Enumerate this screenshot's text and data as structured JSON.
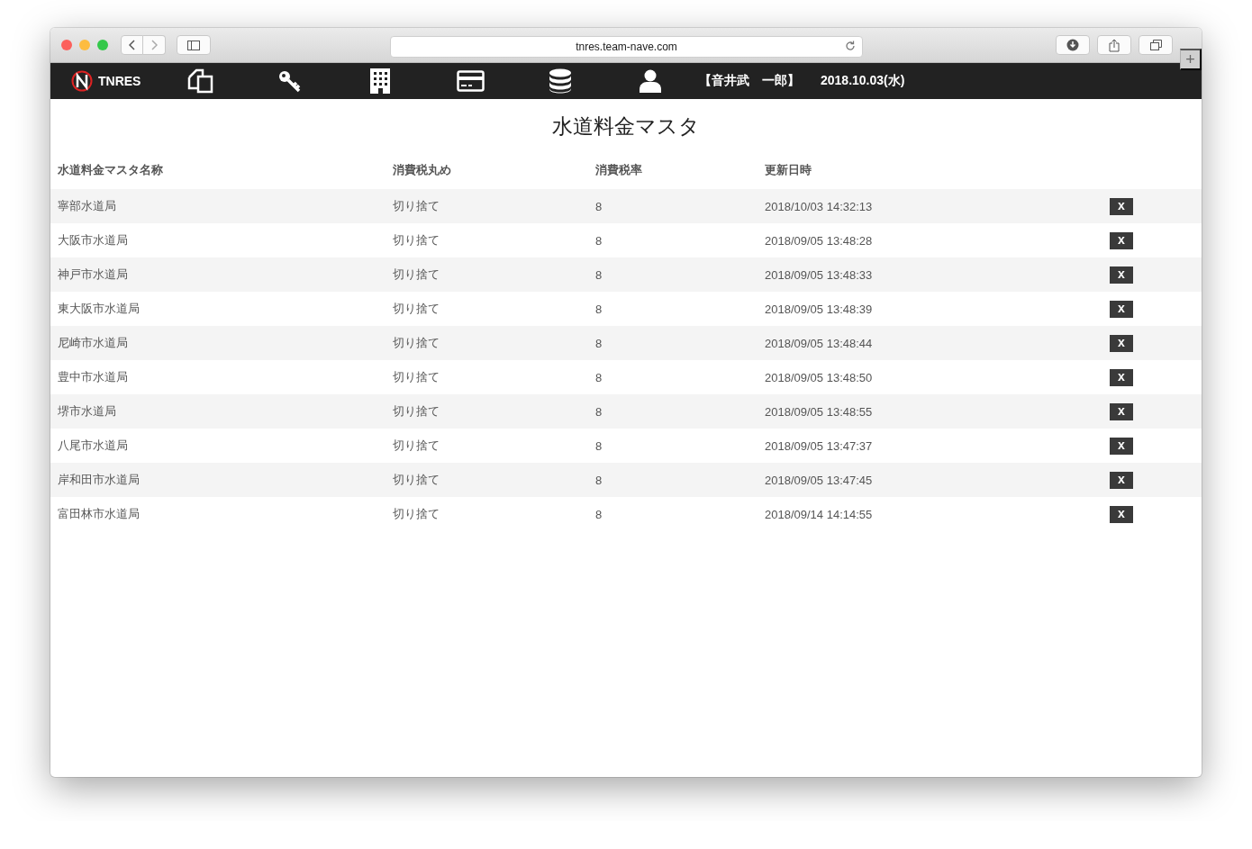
{
  "browser": {
    "url": "tnres.team-nave.com",
    "new_tab": "+"
  },
  "navbar": {
    "brand": "TNRES",
    "user": "【音井武　一郎】",
    "date": "2018.10.03(水)"
  },
  "page": {
    "title": "水道料金マスタ"
  },
  "table": {
    "columns": [
      "水道料金マスタ名称",
      "消費税丸め",
      "消費税率",
      "更新日時"
    ],
    "rows": [
      {
        "name": "寧部水道局",
        "rounding": "切り捨て",
        "rate": "8",
        "updated": "2018/10/03 14:32:13",
        "delete": "x"
      },
      {
        "name": "大阪市水道局",
        "rounding": "切り捨て",
        "rate": "8",
        "updated": "2018/09/05 13:48:28",
        "delete": "x"
      },
      {
        "name": "神戸市水道局",
        "rounding": "切り捨て",
        "rate": "8",
        "updated": "2018/09/05 13:48:33",
        "delete": "x"
      },
      {
        "name": "東大阪市水道局",
        "rounding": "切り捨て",
        "rate": "8",
        "updated": "2018/09/05 13:48:39",
        "delete": "x"
      },
      {
        "name": "尼崎市水道局",
        "rounding": "切り捨て",
        "rate": "8",
        "updated": "2018/09/05 13:48:44",
        "delete": "x"
      },
      {
        "name": "豊中市水道局",
        "rounding": "切り捨て",
        "rate": "8",
        "updated": "2018/09/05 13:48:50",
        "delete": "x"
      },
      {
        "name": "堺市水道局",
        "rounding": "切り捨て",
        "rate": "8",
        "updated": "2018/09/05 13:48:55",
        "delete": "x"
      },
      {
        "name": "八尾市水道局",
        "rounding": "切り捨て",
        "rate": "8",
        "updated": "2018/09/05 13:47:37",
        "delete": "x"
      },
      {
        "name": "岸和田市水道局",
        "rounding": "切り捨て",
        "rate": "8",
        "updated": "2018/09/05 13:47:45",
        "delete": "x"
      },
      {
        "name": "富田林市水道局",
        "rounding": "切り捨て",
        "rate": "8",
        "updated": "2018/09/14 14:14:55",
        "delete": "x"
      }
    ]
  }
}
